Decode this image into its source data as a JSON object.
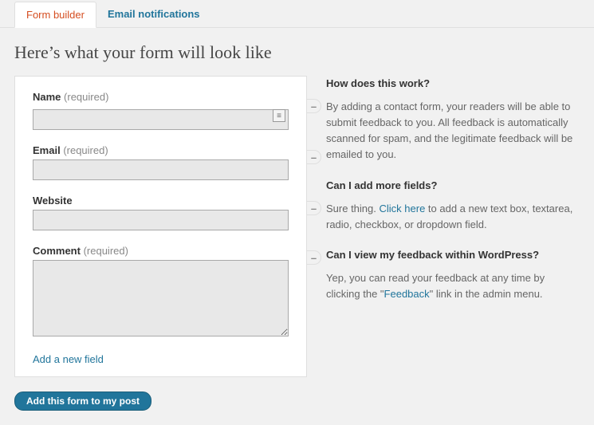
{
  "tabs": {
    "form_builder": "Form builder",
    "email_notifications": "Email notifications"
  },
  "title": "Here’s what your form will look like",
  "fields": {
    "name_label": "Name",
    "name_req": "(required)",
    "email_label": "Email",
    "email_req": "(required)",
    "website_label": "Website",
    "comment_label": "Comment",
    "comment_req": "(required)"
  },
  "add_new_field": "Add a new field",
  "help": {
    "h1": "How does this work?",
    "p1": "By adding a contact form, your readers will be able to submit feedback to you. All feedback is automatically scanned for spam, and the legitimate feedback will be emailed to you.",
    "h2": "Can I add more fields?",
    "p2a": "Sure thing. ",
    "p2link": "Click here",
    "p2b": " to add a new text box, textarea, radio, checkbox, or dropdown field.",
    "h3": "Can I view my feedback within WordPress?",
    "p3a": "Yep, you can read your feedback at any time by clicking the \"",
    "p3link": "Feedback",
    "p3b": "\" link in the admin menu."
  },
  "submit": "Add this form to my post"
}
